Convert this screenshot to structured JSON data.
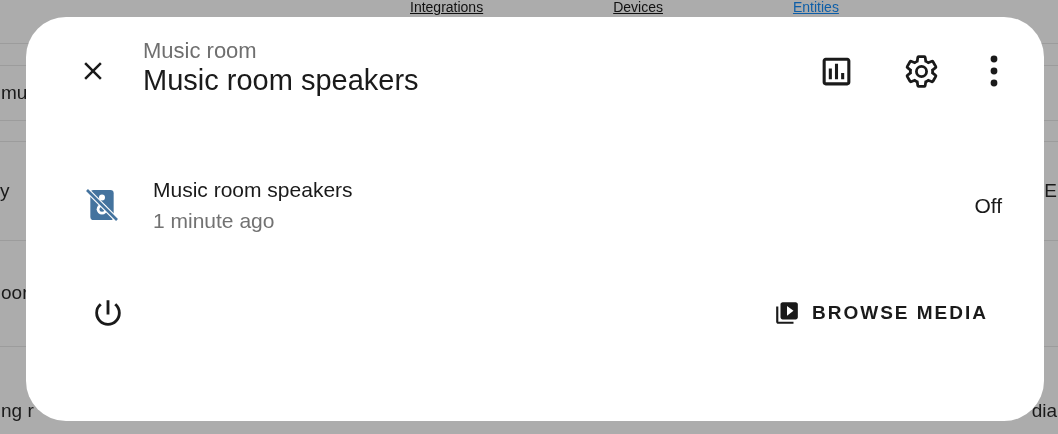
{
  "background": {
    "tabs": [
      {
        "label": "Integrations",
        "selected": false
      },
      {
        "label": "Devices",
        "selected": false
      },
      {
        "label": "Entities",
        "selected": true
      }
    ],
    "rows": [
      {
        "left": "mu"
      },
      {
        "left": "y",
        "right": "E"
      },
      {
        "left": "oor"
      },
      {
        "left": "ng r",
        "right": "dia"
      }
    ]
  },
  "dialog": {
    "area": "Music room",
    "title": "Music room speakers",
    "entity": {
      "name": "Music room speakers",
      "last_changed": "1 minute ago",
      "state": "Off"
    },
    "browse_button": "BROWSE MEDIA"
  }
}
